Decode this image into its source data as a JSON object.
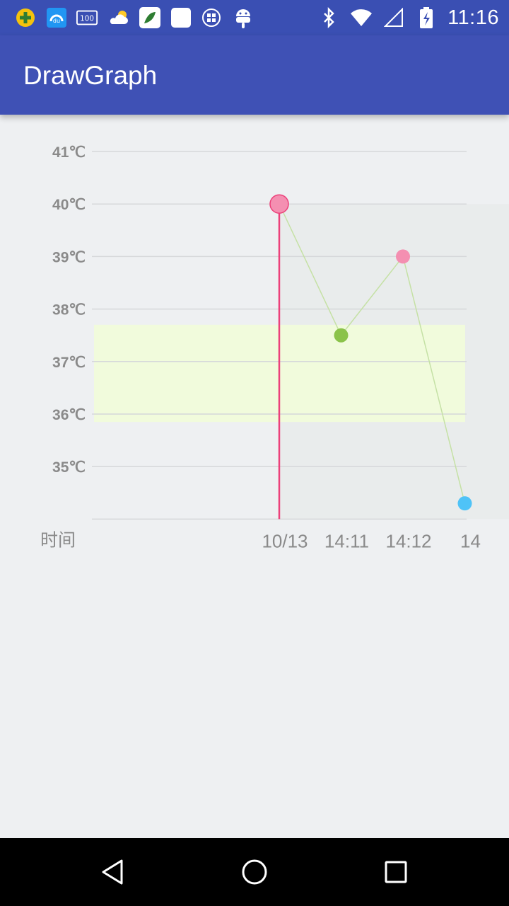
{
  "status_bar": {
    "time": "11:16",
    "left_icons": [
      "plus-badge-icon",
      "baidu-cloud-icon",
      "battery-100-icon",
      "weather-icon",
      "leaf-app-icon",
      "blank-app-icon",
      "gallery-app-icon",
      "android-icon"
    ],
    "right_icons": [
      "bluetooth-icon",
      "wifi-icon",
      "signal-icon",
      "battery-charging-icon"
    ]
  },
  "app_bar": {
    "title": "DrawGraph",
    "color": "#3f51b5"
  },
  "chart_data": {
    "type": "line",
    "xlabel": "时间",
    "ylabel": "",
    "y_tick_labels": [
      "41℃",
      "40℃",
      "39℃",
      "38℃",
      "37℃",
      "36℃",
      "35℃"
    ],
    "y_ticks": [
      41,
      40,
      39,
      38,
      37,
      36,
      35
    ],
    "ylim": [
      34,
      41
    ],
    "x_tick_labels": [
      "10/13",
      "14:11",
      "14:12",
      "14"
    ],
    "x_tick_index": [
      0,
      1,
      2,
      3
    ],
    "normal_range": [
      35.85,
      37.7
    ],
    "grid": true,
    "points": [
      {
        "x_index": 0,
        "y": 40.0,
        "color": "#f48fb1",
        "selected": true
      },
      {
        "x_index": 1,
        "y": 37.5,
        "color": "#8bc34a"
      },
      {
        "x_index": 2,
        "y": 39.0,
        "color": "#f48fb1"
      },
      {
        "x_index": 3,
        "y": 34.3,
        "color": "#4fc3f7"
      }
    ],
    "colors": {
      "line": "#c5e1a5",
      "selected_line": "#ec407a",
      "normal_band": "#f1fbdc",
      "grid": "#d6d8da",
      "label": "#8a8a8a"
    }
  },
  "nav_bar": {
    "icons": [
      "back-icon",
      "home-icon",
      "recents-icon"
    ]
  }
}
